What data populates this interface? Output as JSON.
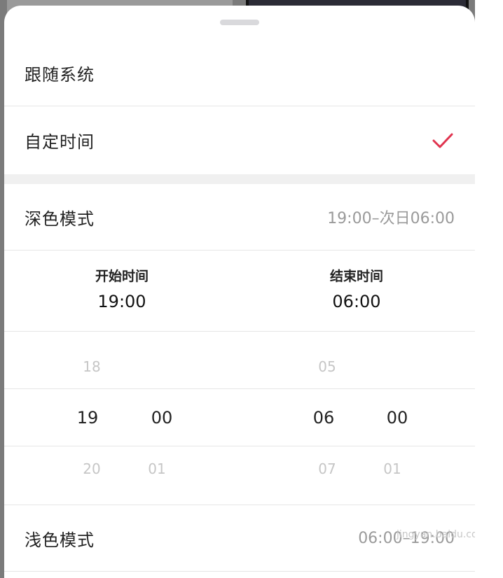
{
  "options": {
    "follow_system": "跟随系统",
    "custom_time": "自定时间",
    "custom_selected": true
  },
  "dark_mode": {
    "label": "深色模式",
    "range": "19:00–次日06:00"
  },
  "time_range": {
    "start_title": "开始时间",
    "start_time": "19:00",
    "end_title": "结束时间",
    "end_time": "06:00"
  },
  "start_picker": {
    "hour_prev": "18",
    "hour": "19",
    "hour_next": "20",
    "minute": "00",
    "minute_next": "01"
  },
  "end_picker": {
    "hour_prev": "05",
    "hour": "06",
    "hour_next": "07",
    "minute": "00",
    "minute_next": "01"
  },
  "light_mode": {
    "label": "浅色模式",
    "range": "06:00–19:00"
  },
  "colors": {
    "accent": "#e0344f"
  },
  "watermark": "jingyan.baidu.com"
}
